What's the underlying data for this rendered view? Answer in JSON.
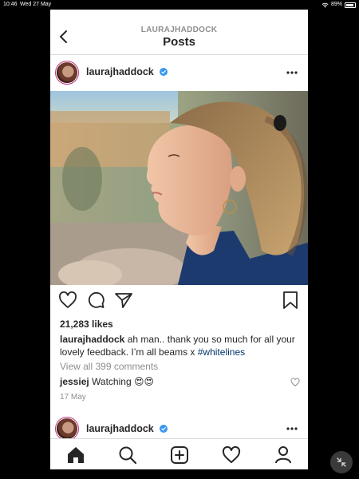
{
  "status_bar": {
    "time": "10:46",
    "date": "Wed 27 May",
    "battery": "89%",
    "battery_level": 0.89
  },
  "nav": {
    "username": "LAURAJHADDOCK",
    "title": "Posts",
    "back_icon": "chevron-left-icon"
  },
  "post": {
    "username": "laurajhaddock",
    "likes": "21,283 likes",
    "caption_user": "laurajhaddock",
    "caption_text": " ah man.. thank you so much for all your lovely feedback. I’m all beams x ",
    "caption_tag": "#whitelines",
    "view_comments": "View all 399 comments",
    "comment_user": "jessiej",
    "comment_text": " Watching 😍😍",
    "date": "17 May"
  },
  "next_post": {
    "username": "laurajhaddock"
  },
  "icons": {
    "verified": "verified-badge-icon",
    "more": "more-options-icon",
    "like": "heart-icon",
    "comment": "comment-icon",
    "share": "paper-plane-icon",
    "save": "bookmark-icon",
    "home": "home-icon",
    "search": "search-icon",
    "new_post": "add-post-icon",
    "activity": "heart-icon",
    "profile": "profile-icon"
  },
  "colors": {
    "verified_blue": "#3897f0",
    "hashtag": "#003569",
    "muted_text": "#8e8e8e",
    "divider": "#dbdbdb"
  }
}
